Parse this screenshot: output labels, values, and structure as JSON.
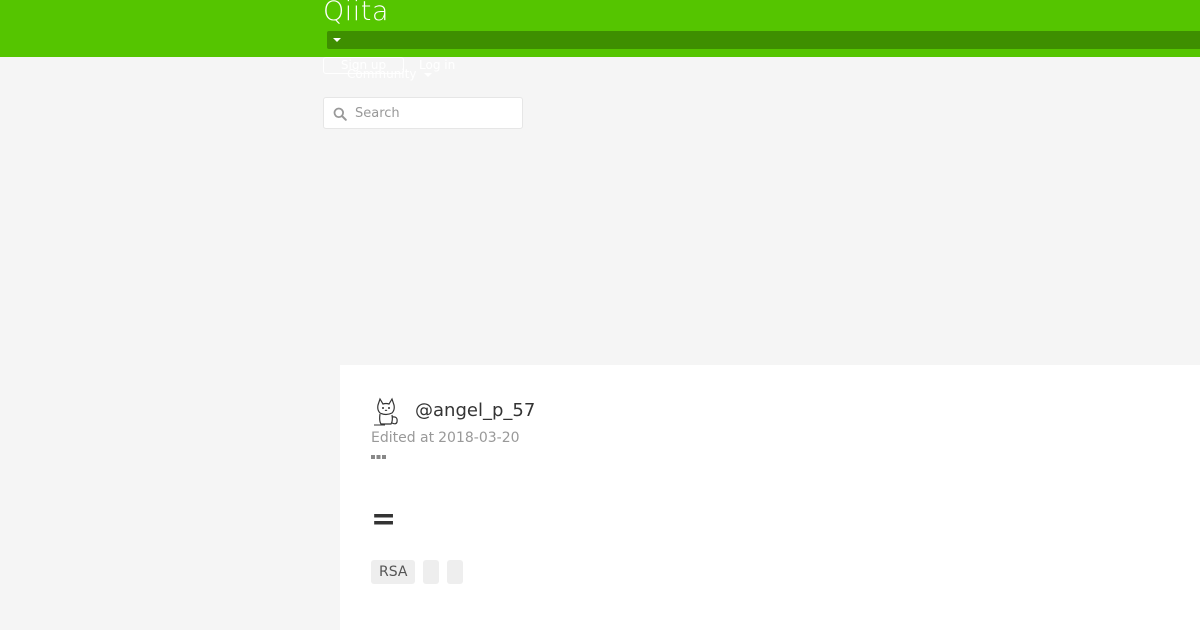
{
  "header": {
    "logo_text": "Qiita",
    "brand_color": "#55c500",
    "menu_bar_color": "#3e8f00",
    "signup_label": "Sign up",
    "login_label": "Log in",
    "community_label": "Community",
    "search": {
      "placeholder": "Search",
      "value": "",
      "icon": "search-icon"
    }
  },
  "article": {
    "author": {
      "handle": "@angel_p_57",
      "avatar_icon": "cat-avatar-icon"
    },
    "edited_label": "Edited at",
    "edited_date": "2018-03-20",
    "more_icon": "more-dots-icon",
    "title": "=",
    "tags": [
      {
        "label": "RSA"
      },
      {
        "label": ""
      },
      {
        "label": ""
      }
    ]
  },
  "colors": {
    "page_background": "#f5f5f5",
    "card_background": "#ffffff",
    "tag_background": "#eeeeee",
    "muted_text": "#999999"
  }
}
